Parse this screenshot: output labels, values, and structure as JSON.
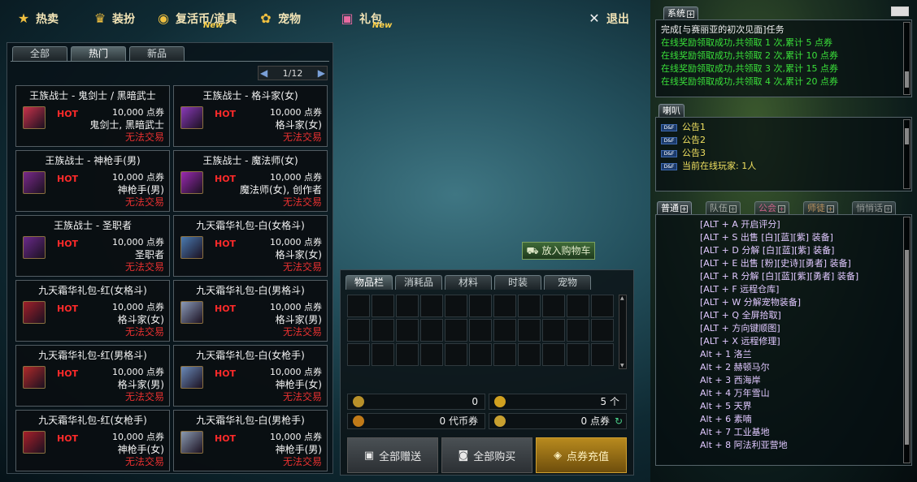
{
  "nav": {
    "items": [
      {
        "label": "热卖",
        "icon": "star-icon",
        "new": ""
      },
      {
        "label": "装扮",
        "icon": "trophy-icon",
        "new": ""
      },
      {
        "label": "复活币/道具",
        "icon": "coin-icon",
        "new": "New"
      },
      {
        "label": "宠物",
        "icon": "paw-icon",
        "new": ""
      },
      {
        "label": "礼包",
        "icon": "gift-icon",
        "new": "New"
      }
    ],
    "exit": "退出"
  },
  "shop": {
    "tabs": [
      "全部",
      "热门",
      "新品"
    ],
    "active_tab": "热门",
    "page": "1/12",
    "items": [
      {
        "name": "王族战士 - 鬼剑士 / 黑暗武士",
        "hot": "HOT",
        "price": "10,000 点券",
        "who": "鬼剑士, 黑暗武士",
        "trade": "无法交易",
        "color": "#c8324a"
      },
      {
        "name": "王族战士 - 格斗家(女)",
        "hot": "HOT",
        "price": "10,000 点券",
        "who": "格斗家(女)",
        "trade": "无法交易",
        "color": "#8a3ab8"
      },
      {
        "name": "王族战士 - 神枪手(男)",
        "hot": "HOT",
        "price": "10,000 点券",
        "who": "神枪手(男)",
        "trade": "无法交易",
        "color": "#7a2a8a"
      },
      {
        "name": "王族战士 - 魔法师(女)",
        "hot": "HOT",
        "price": "10,000 点券",
        "who": "魔法师(女), 创作者",
        "trade": "无法交易",
        "color": "#9a2ab0"
      },
      {
        "name": "王族战士 - 圣职者",
        "hot": "HOT",
        "price": "10,000 点券",
        "who": "圣职者",
        "trade": "无法交易",
        "color": "#6a2a8a"
      },
      {
        "name": "九天霜华礼包-白(女格斗)",
        "hot": "HOT",
        "price": "10,000 点券",
        "who": "格斗家(女)",
        "trade": "无法交易",
        "color": "#4a7ab0"
      },
      {
        "name": "九天霜华礼包-红(女格斗)",
        "hot": "HOT",
        "price": "10,000 点券",
        "who": "格斗家(女)",
        "trade": "无法交易",
        "color": "#a0202a"
      },
      {
        "name": "九天霜华礼包-白(男格斗)",
        "hot": "HOT",
        "price": "10,000 点券",
        "who": "格斗家(男)",
        "trade": "无法交易",
        "color": "#8a9ab8"
      },
      {
        "name": "九天霜华礼包-红(男格斗)",
        "hot": "HOT",
        "price": "10,000 点券",
        "who": "格斗家(男)",
        "trade": "无法交易",
        "color": "#b02a2a"
      },
      {
        "name": "九天霜华礼包-白(女枪手)",
        "hot": "HOT",
        "price": "10,000 点券",
        "who": "神枪手(女)",
        "trade": "无法交易",
        "color": "#6a8ab8"
      },
      {
        "name": "九天霜华礼包-红(女枪手)",
        "hot": "HOT",
        "price": "10,000 点券",
        "who": "神枪手(女)",
        "trade": "无法交易",
        "color": "#a8202a"
      },
      {
        "name": "九天霜华礼包-白(男枪手)",
        "hot": "HOT",
        "price": "10,000 点券",
        "who": "神枪手(男)",
        "trade": "无法交易",
        "color": "#8a9ab0"
      }
    ]
  },
  "cart_button": "放入购物车",
  "inventory": {
    "tabs": [
      "物品栏",
      "消耗品",
      "材料",
      "时装",
      "宠物"
    ],
    "active_tab": "物品栏",
    "money": [
      {
        "value": "0",
        "icon": "gold-coin-icon"
      },
      {
        "value": "5 个",
        "icon": "revive-coin-icon"
      },
      {
        "value": "0 代币券",
        "icon": "token-icon"
      },
      {
        "value": "0 点券",
        "icon": "point-icon"
      }
    ],
    "buttons": {
      "gift_all": "全部赠送",
      "buy_all": "全部购买",
      "recharge": "点券充值"
    }
  },
  "system": {
    "tab": "系统",
    "lines": [
      {
        "text": "完成[与赛丽亚的初次见面]任务",
        "color": "#f0f0f0"
      },
      {
        "text": "在线奖励领取成功,共领取 1 次,累计 5 点券",
        "color": "#3ae03a"
      },
      {
        "text": "在线奖励领取成功,共领取 2 次,累计 10 点券",
        "color": "#3ae03a"
      },
      {
        "text": "在线奖励领取成功,共领取 3 次,累计 15 点券",
        "color": "#3ae03a"
      },
      {
        "text": "在线奖励领取成功,共领取 4 次,累计 20 点券",
        "color": "#3ae03a"
      }
    ]
  },
  "horn": {
    "tab": "喇叭",
    "lines": [
      "公告1",
      "公告2",
      "公告3",
      "当前在线玩家: 1人"
    ]
  },
  "chat": {
    "tabs": [
      "普通",
      "队伍",
      "公会",
      "师徒",
      "悄悄话"
    ],
    "lines": [
      "[ALT + A    开启评分]",
      "[ALT + S    出售 [白][蓝][紫] 装备]",
      "[ALT + D    分解 [白][蓝][紫] 装备]",
      "[ALT + E    出售 [粉][史诗][勇者] 装备]",
      "[ALT + R    分解 [白][蓝][紫][勇者] 装备]",
      "[ALT + F    远程仓库]",
      "[ALT + W    分解宠物装备]",
      "[ALT + Q    全屏拾取]",
      "[ALT + 方向键顺图]",
      "[ALT + X 远程修理]",
      "Alt + 1    洛兰",
      "Alt + 2    赫顿马尔",
      "Alt + 3    西海岸",
      "Alt + 4    万年雪山",
      "Alt + 5    天界",
      "Alt + 6    素喃",
      "Alt + 7    工业基地",
      "Alt + 8    阿法利亚营地"
    ]
  }
}
